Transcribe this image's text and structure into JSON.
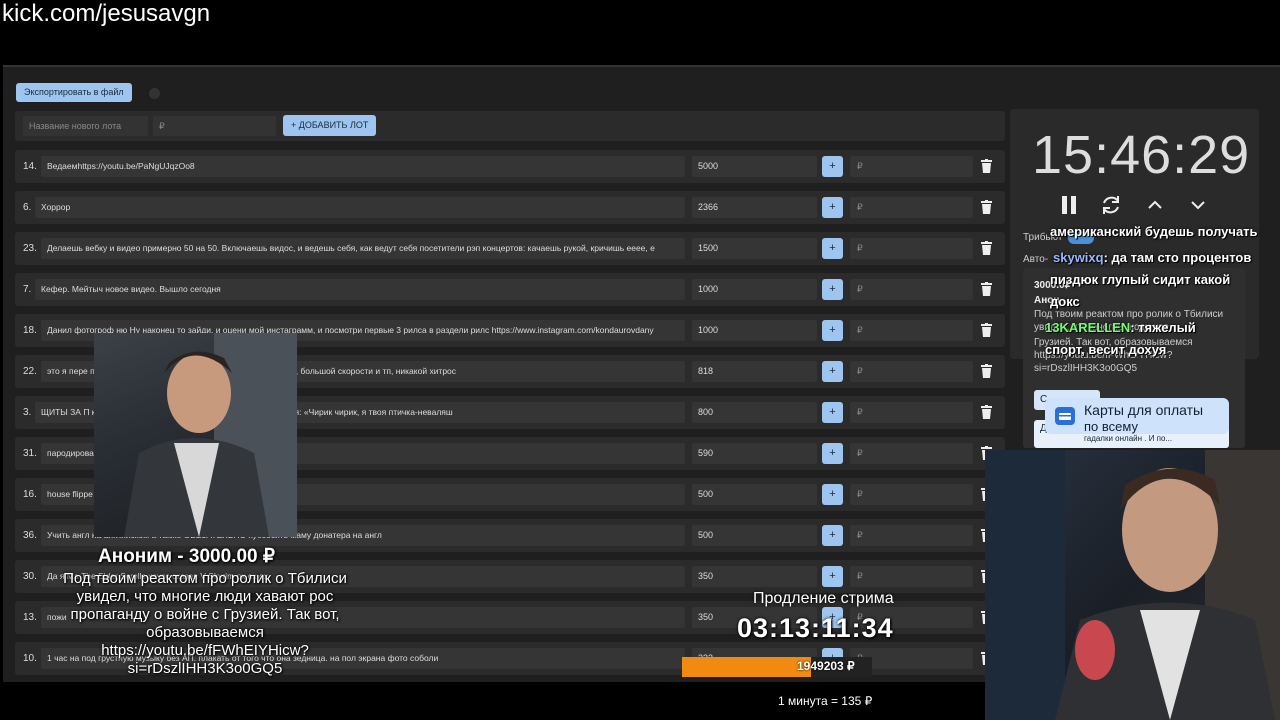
{
  "url": "kick.com/jesusavgn",
  "toolbar": {
    "export_label": "Экспортировать в файл"
  },
  "new_lot": {
    "name_placeholder": "Название нового лота",
    "rub_placeholder": "₽",
    "add_label": "+ ДОБАВИТЬ ЛОТ"
  },
  "lots": [
    {
      "num": "14.",
      "name": "Ведаемhttps://youtu.be/PaNgUJqzOo8",
      "sum": "5000",
      "rub": "₽"
    },
    {
      "num": "6.",
      "name": "Хоррор",
      "sum": "2366",
      "rub": "₽"
    },
    {
      "num": "23.",
      "name": "Делаешь вебку и видео примерно 50 на 50. Включаешь видос, и ведешь себя, как ведут себя посетители рэп концертов: качаешь рукой, кричишь еееe, е",
      "sum": "1500",
      "rub": "₽"
    },
    {
      "num": "7.",
      "name": "Кефер. Мейтыч новое видео. Вышло сегодня",
      "sum": "1000",
      "rub": "₽"
    },
    {
      "num": "18.",
      "name": "Данил фотогроф ню Ну наконец то зайди, и оцени мой инстаграмм, и посмотри первые 3 рилса в раздели рилс https://www.instagram.com/kondaurovdany",
      "sum": "1000",
      "rub": "₽"
    },
    {
      "num": "22.",
      "name": "это я пере                                                   прохождерию the curse of black water без перемотки, большой скорости и тп, никакой хитрос",
      "sum": "818",
      "rub": "₽"
    },
    {
      "num": "3.",
      "name": "ЩИТЫ ЗА П                                                     крылышки)и час после «летаешь» на месте чирикая: «Чирик чирик, я твоя птичка-неваляш",
      "sum": "800",
      "rub": "₽"
    },
    {
      "num": "31.",
      "name": "пародирова",
      "sum": "590",
      "rub": "₽"
    },
    {
      "num": "16.",
      "name": "house flippe",
      "sum": "500",
      "rub": "₽"
    },
    {
      "num": "36.",
      "name": "Учить англ                                                   на английском а также ОБЕЗАТЕЛЬНО хуесосить маму донатера на англ",
      "sum": "500",
      "rub": "₽"
    },
    {
      "num": "30.",
      "name": "Да я Ма                  The Elder Scrolls хеусс сказав V Skyrim ох ох ох",
      "sum": "350",
      "rub": "₽"
    },
    {
      "num": "13.",
      "name": "пожи",
      "sum": "350",
      "rub": "₽"
    },
    {
      "num": "10.",
      "name": "1 час на                                      под грустную музыку без АП. плакать от того что она зедница. на пол экрана фото соболи",
      "sum": "333",
      "rub": "₽"
    }
  ],
  "timer": {
    "time": "15:46:29"
  },
  "sidebar": {
    "label_tribute": "Трибьют",
    "label_auto": "Авто-"
  },
  "donation_card": {
    "amount": "3000.0₽",
    "who": "Анон",
    "text": "Под твоим реактом про ролик о Тбилиси увидел, что многие люди хав",
    "text2": "Грузией. Так вот, образовываемся https://youtu.be/fFWhEIYHicw?si=rDszlIHH3K3o0GQ5",
    "gadalki": "гадалки онлайн . И по...",
    "btn_a": "С",
    "btn_d": "Д"
  },
  "chat": [
    {
      "text": "американский будешь получать"
    },
    {
      "user": "skywixq",
      "text": ": да там сто процентов"
    },
    {
      "text": "пиздюк глупый сидит какой"
    },
    {
      "text": "докс"
    },
    {
      "user": "13KARELLEN",
      "text": ": тяжелый"
    },
    {
      "text": "спорт, весит дохуя"
    }
  ],
  "cards_popup": {
    "line1": "Карты для оплаты",
    "line2": "по всему"
  },
  "alert": {
    "title": "Аноним - 3000.00 ₽",
    "message": "Под твоим реактом про ролик о Тбилиси увидел, что многие люди хавают рос пропаганду о войне с Грузией. Так вот, образовываемся https://youtu.be/fFWhEIYHicw?si=rDszlIHH3K3o0GQ5"
  },
  "extension": {
    "label": "Продление стрима",
    "time": "03:13:11:34",
    "amount": "1949203 ₽",
    "progress": 0.68,
    "rate": "1 минута = 135 ₽"
  },
  "colors": {
    "accent": "#9ec5f0",
    "progress": "#f08a10",
    "bg": "#1f1f1f"
  }
}
